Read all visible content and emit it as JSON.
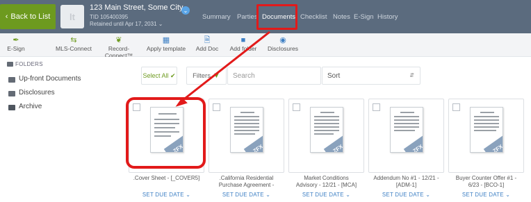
{
  "header": {
    "back_label": "Back to List",
    "thumb_text": "lt",
    "address": "123 Main Street, Some City",
    "tid": "TID 105400395",
    "retained": "Retained until Apr 17, 2031",
    "nav": [
      "Summary",
      "Parties",
      "Documents",
      "Checklist",
      "Notes",
      "E-Sign",
      "History"
    ],
    "active_nav": "Documents"
  },
  "toolbar": {
    "items": [
      "E-Sign",
      "MLS-Connect",
      "Record-Connect™",
      "Apply template",
      "Add Doc",
      "Add folder",
      "Disclosures"
    ]
  },
  "sidebar": {
    "heading": "FOLDERS",
    "folders": [
      "Up-front Documents",
      "Disclosures",
      "Archive"
    ]
  },
  "filters": {
    "select_all": "Select All",
    "filters_label": "Filters",
    "search_placeholder": "Search",
    "sort_label": "Sort"
  },
  "documents": [
    {
      "name": ".Cover Sheet - [_COVER5]",
      "line2": "",
      "due": "SET DUE DATE"
    },
    {
      "name": ".California Residential",
      "line2": "Purchase Agreement -",
      "due": "SET DUE DATE"
    },
    {
      "name": "Market Conditions",
      "line2": "Advisory - 12/21 - [MCA]",
      "due": "SET DUE DATE"
    },
    {
      "name": "Addendum No #1 - 12/21 -",
      "line2": "[ADM-1]",
      "due": "SET DUE DATE"
    },
    {
      "name": "Buyer Counter Offer #1 -",
      "line2": "6/23 - [BCO-1]",
      "due": "SET DUE DATE"
    }
  ],
  "badge_text": "ZFX",
  "colors": {
    "header_bg": "#5b6b7e",
    "back_green": "#6d9a1f",
    "accent_blue": "#3d7fc4",
    "annotation_red": "#e21a1a"
  }
}
